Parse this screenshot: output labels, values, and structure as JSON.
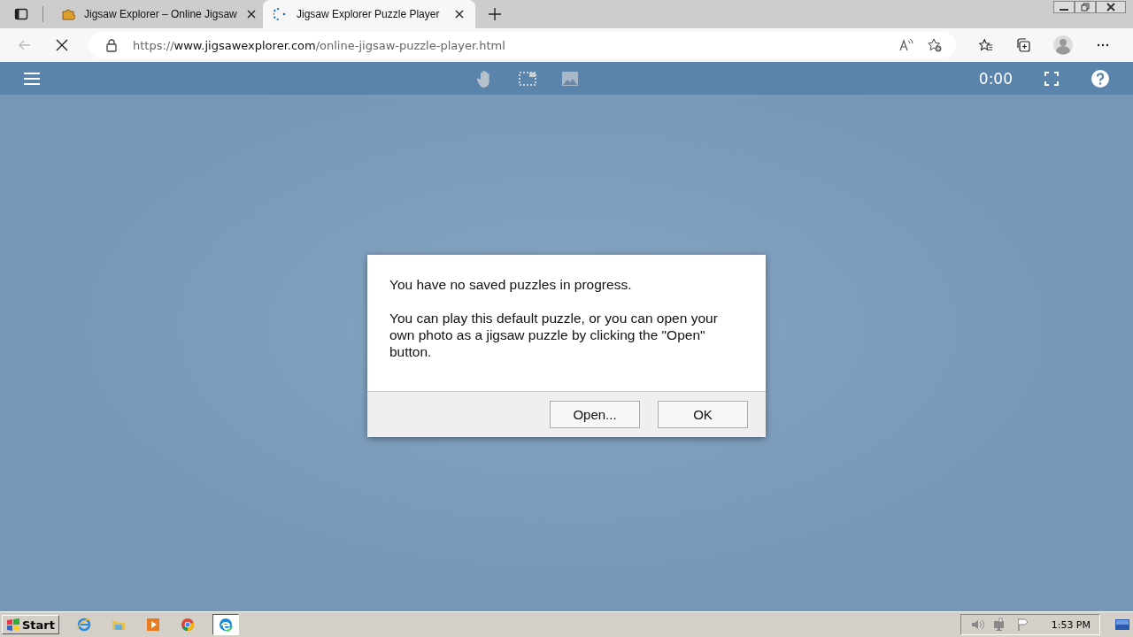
{
  "browser": {
    "tabs": [
      {
        "title": "Jigsaw Explorer – Online Jigsaw",
        "selected": false,
        "loading": false
      },
      {
        "title": "Jigsaw Explorer Puzzle Player",
        "selected": true,
        "loading": true
      }
    ],
    "address": {
      "scheme": "https://",
      "host": "www.jigsawexplorer.com",
      "path": "/online-jigsaw-puzzle-player.html"
    },
    "page_loading": true
  },
  "toolbar": {
    "timer": "0:00"
  },
  "dialog": {
    "paragraphs": [
      "You have no saved puzzles in progress.",
      "You can play this default puzzle, or you can open your own photo as a jigsaw puzzle by clicking the \"Open\" button."
    ],
    "buttons": [
      "Open...",
      "OK"
    ]
  },
  "taskbar": {
    "start": "Start",
    "apps": [
      {
        "kind": "ie",
        "selected": false
      },
      {
        "kind": "folder",
        "selected": false
      },
      {
        "kind": "media",
        "selected": false
      },
      {
        "kind": "chrome",
        "selected": false
      },
      {
        "kind": "edge",
        "selected": true
      }
    ],
    "clock": "1:53 PM"
  }
}
